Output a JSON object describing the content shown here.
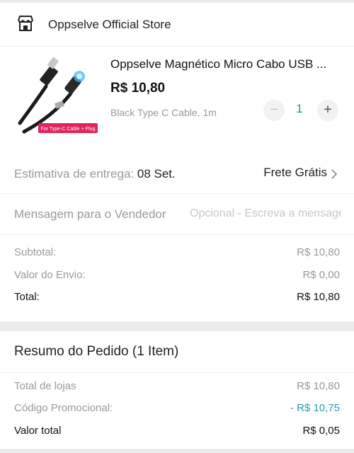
{
  "store": {
    "name": "Oppselve Official Store",
    "icon": "storefront-icon"
  },
  "product": {
    "title": "Oppselve Magnético Micro Cabo USB ...",
    "price": "R$ 10,80",
    "variant": "Black Type C Cable, 1m",
    "image_badge": "For Type-C Cable + Plug",
    "quantity": "1",
    "minus_label": "−",
    "plus_label": "+"
  },
  "delivery": {
    "label": "Estimativa de entrega: ",
    "date": "08 Set.",
    "shipping": "Frete Grátis"
  },
  "message": {
    "label": "Mensagem para o Vendedor",
    "placeholder": "Opcional - Escreva a mensagem"
  },
  "totals": {
    "subtotal_label": "Subtotal:",
    "subtotal_value": "R$ 10,80",
    "shipping_label": "Valor do Envio:",
    "shipping_value": "R$ 0,00",
    "total_label": "Total:",
    "total_value": "R$ 10,80"
  },
  "summary": {
    "title": "Resumo do Pedido (1 Item)",
    "stores_label": "Total de lojas",
    "stores_value": "R$ 10,80",
    "promo_label": "Código Promocional:",
    "promo_value": "- R$ 10,75",
    "grand_label": "Valor total",
    "grand_value": "R$ 0,05"
  },
  "colors": {
    "accent": "#2a9bb0",
    "muted_text": "#9a9a9a",
    "badge": "#e0245e"
  }
}
